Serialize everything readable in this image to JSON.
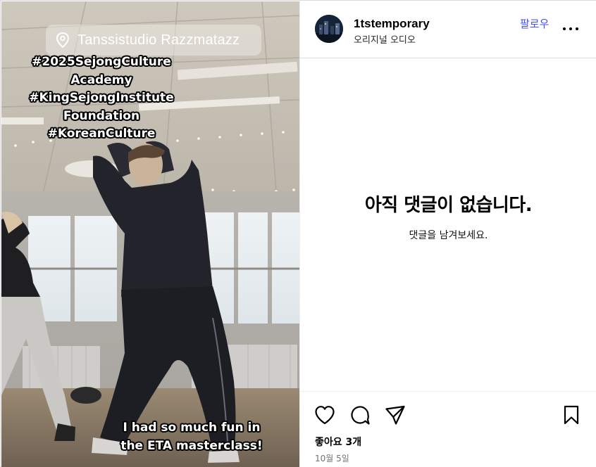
{
  "post": {
    "location": "Tanssistudio Razzmatazz",
    "hashtag_lines": [
      "#2025SejongCulture",
      "Academy",
      "#KingSejongInstitute",
      "Foundation",
      "#KoreanCulture"
    ],
    "caption_lines": [
      "I had so much fun in",
      "the ETA masterclass!"
    ]
  },
  "header": {
    "username": "1tstemporary",
    "audio": "오리지널 오디오",
    "follow_label": "팔로우"
  },
  "comments": {
    "empty_title": "아직 댓글이 없습니다.",
    "empty_subtitle": "댓글을 남겨보세요."
  },
  "actions": {
    "likes": "좋아요 3개",
    "date": "10월 5일"
  },
  "icons": {
    "like": "heart-icon",
    "comment": "comment-icon",
    "share": "send-icon",
    "save": "bookmark-icon",
    "more": "more-icon",
    "location": "location-pin-icon"
  },
  "colors": {
    "follow": "#4150f7",
    "secondary_text": "#737373",
    "border": "#dbdbdb"
  }
}
